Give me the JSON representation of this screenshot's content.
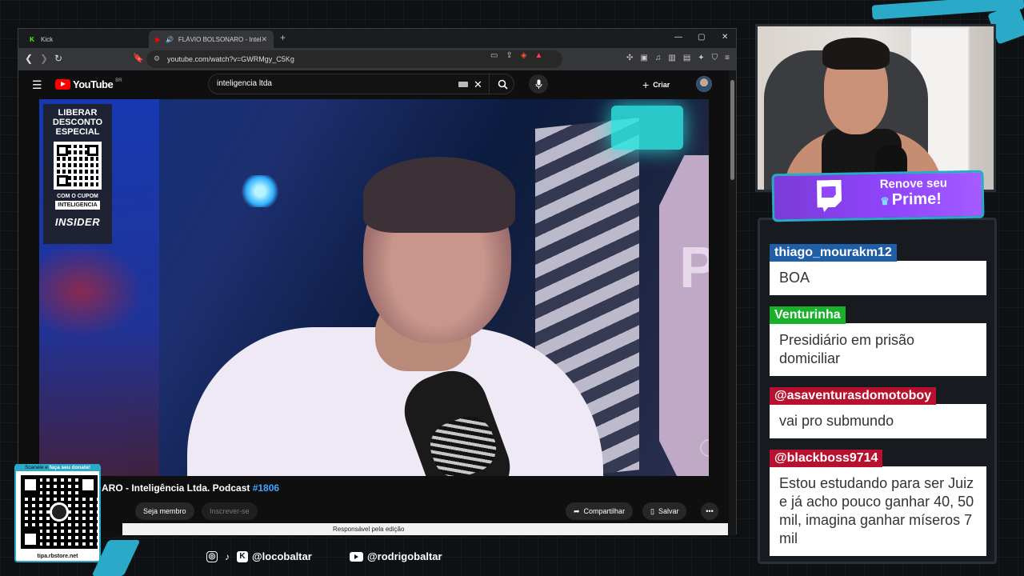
{
  "browser": {
    "tabs": [
      {
        "label": "Kick",
        "active": false
      },
      {
        "label": "FLÁVIO BOLSONARO - Inteligência Ltda.",
        "active": true
      }
    ],
    "url": "youtube.com/watch?v=GWRMgy_C5Kg"
  },
  "youtube": {
    "logo_text": "YouTube",
    "country": "BR",
    "search_value": "inteligencia ltda",
    "create_label": "Criar",
    "video_title_text": "ARO - Inteligência Ltda. Podcast ",
    "video_title_tag": "#1806",
    "member_label": "Seja membro",
    "subscribe_label": "Inscrever-se",
    "share_label": "Compartilhar",
    "save_label": "Salvar",
    "description_snippet": "Responsável pela edição",
    "promo": {
      "title": "LIBERAR DESCONTO ESPECIAL",
      "coupon_label": "COM O CUPOM",
      "coupon_code": "INTELIGENCIA",
      "brand": "INSIDER"
    },
    "video_sign_text": "PA"
  },
  "donation": {
    "label_prefix": "Scaneie e ",
    "label_emphasis": "faça seu donate!",
    "url": "tipa.rbstore.net"
  },
  "socials": [
    {
      "handle": "@locobaltar",
      "icons": [
        "instagram-icon",
        "tiktok-icon",
        "kick-icon"
      ]
    },
    {
      "handle": "@rodrigobaltar",
      "icons": [
        "youtube-icon"
      ]
    }
  ],
  "prime_banner": {
    "line1": "Renove seu",
    "line2": "Prime!"
  },
  "chat": {
    "messages": [
      {
        "user": "thiago_mourakm12",
        "color": "#1f5fa8",
        "text": "BOA"
      },
      {
        "user": "Venturinha",
        "color": "#19b02a",
        "text": "Presidiário em prisão domiciliar"
      },
      {
        "user": "@asaventurasdomotoboy",
        "color": "#b8112f",
        "text": "vai pro submundo"
      },
      {
        "user": "@blackboss9714",
        "color": "#b8112f",
        "text": "Estou estudando para ser Juiz e já acho pouco ganhar 40, 50 mil, imagina ganhar míseros 7 mil"
      }
    ]
  },
  "colors": {
    "accent": "#2aa9c8",
    "twitch": "#9146ff",
    "yt_red": "#ff0000"
  }
}
